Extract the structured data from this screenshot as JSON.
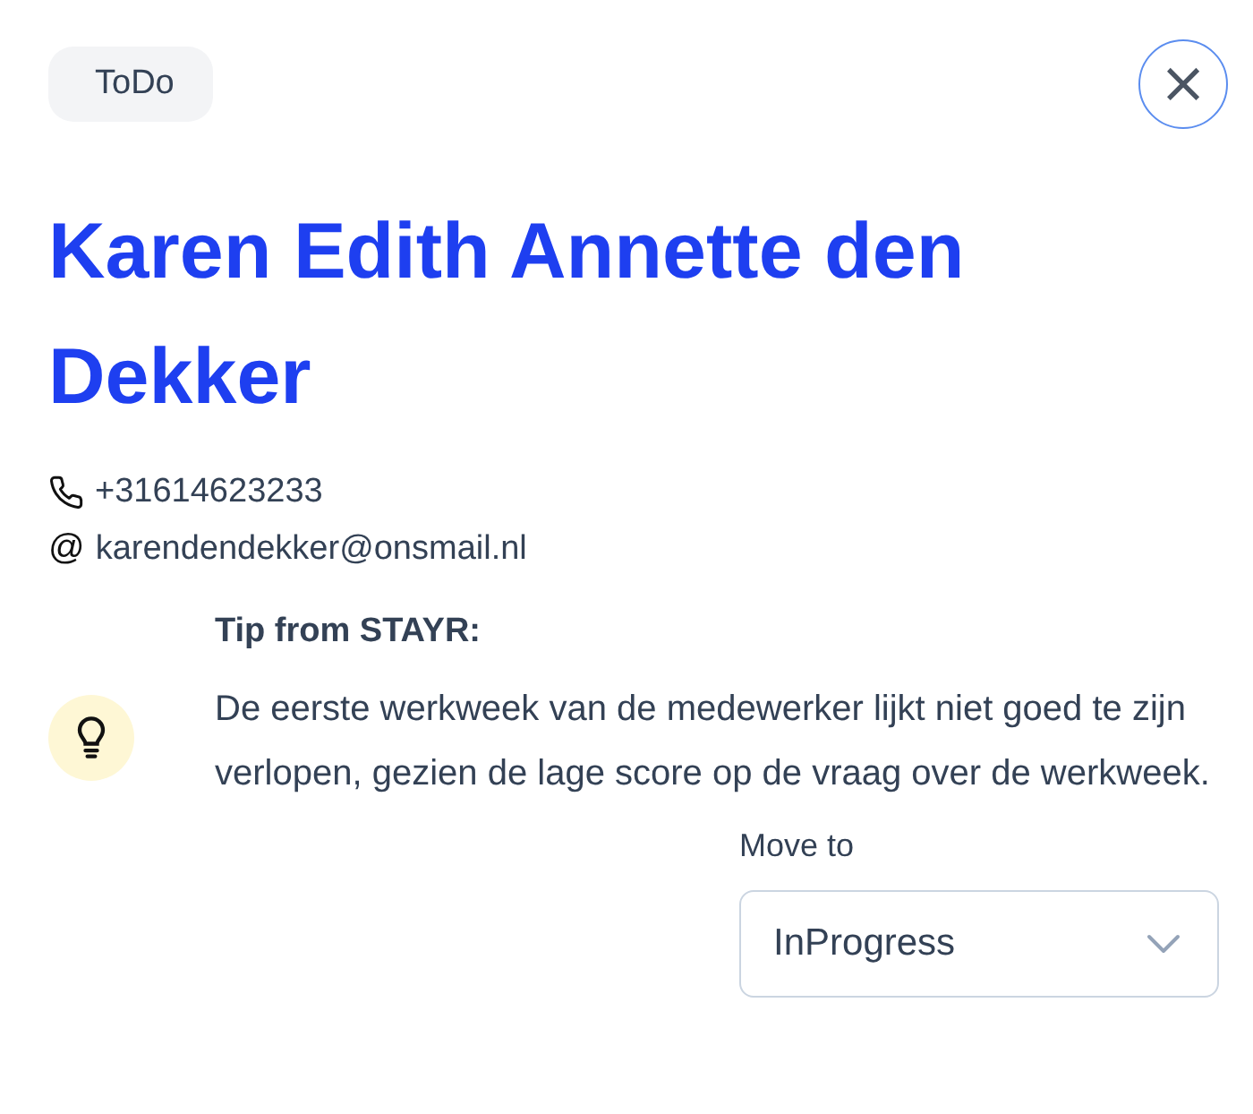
{
  "status_badge": "ToDo",
  "close_button": {
    "label": "×"
  },
  "name": "Karen Edith Annette den Dekker",
  "contact": [
    {
      "kind": "phone",
      "value": "+31614623233"
    },
    {
      "kind": "email",
      "prefix": "@",
      "value": "karendendekker@onsmail.nl"
    }
  ],
  "tip": {
    "title": "Tip from STAYR:",
    "text": "De eerste werkweek van de medewerker lijkt niet goed te zijn verlopen, gezien de lage score op de vraag over de werkweek."
  },
  "move_to": {
    "label": "Move to",
    "value": "InProgress"
  }
}
